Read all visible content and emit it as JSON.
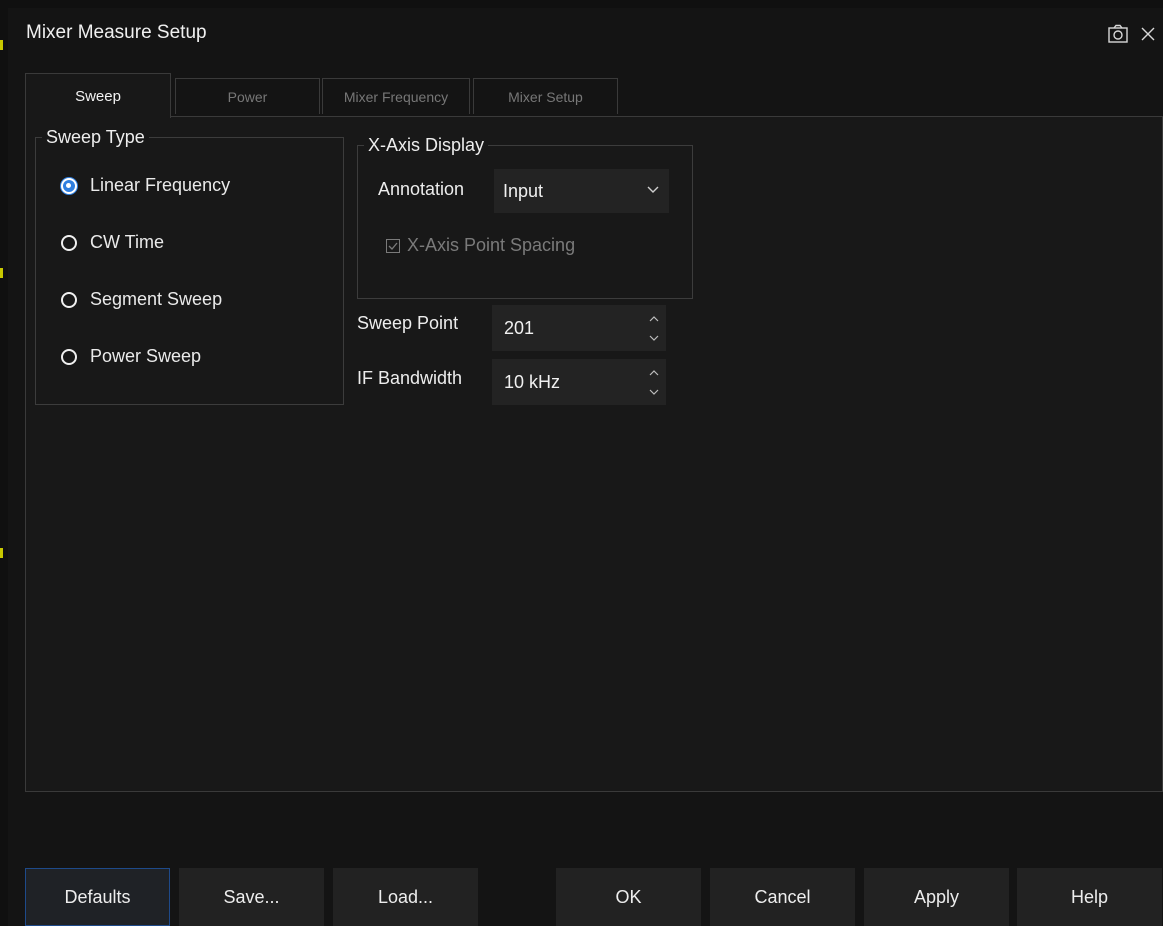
{
  "window": {
    "title": "Mixer Measure Setup"
  },
  "titlebar_icons": {
    "camera": "camera-icon",
    "close": "close-icon"
  },
  "tabs": [
    {
      "label": "Sweep",
      "active": true
    },
    {
      "label": "Power",
      "active": false
    },
    {
      "label": "Mixer Frequency",
      "active": false
    },
    {
      "label": "Mixer Setup",
      "active": false
    }
  ],
  "sweep_type": {
    "legend": "Sweep Type",
    "options": [
      {
        "label": "Linear Frequency",
        "checked": true
      },
      {
        "label": "CW Time",
        "checked": false
      },
      {
        "label": "Segment Sweep",
        "checked": false
      },
      {
        "label": "Power Sweep",
        "checked": false
      }
    ]
  },
  "x_axis": {
    "legend": "X-Axis Display",
    "annotation_label": "Annotation",
    "annotation_value": "Input",
    "point_spacing_label": "X-Axis Point Spacing",
    "point_spacing_checked": true,
    "point_spacing_enabled": false
  },
  "sweep_point": {
    "label": "Sweep Point",
    "value": "201"
  },
  "if_bandwidth": {
    "label": "IF Bandwidth",
    "value": "10 kHz"
  },
  "buttons": {
    "defaults": "Defaults",
    "save": "Save...",
    "load": "Load...",
    "ok": "OK",
    "cancel": "Cancel",
    "apply": "Apply",
    "help": "Help"
  },
  "colors": {
    "accent": "#2f7fe0",
    "background": "#181818",
    "field": "#232323"
  }
}
